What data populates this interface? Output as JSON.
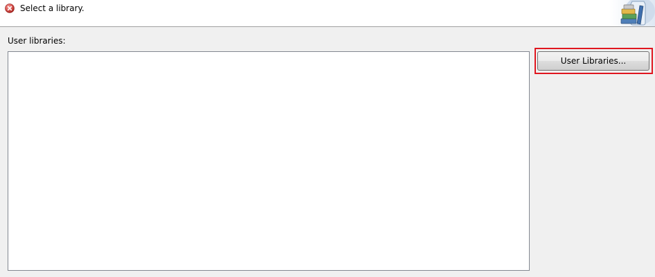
{
  "header": {
    "message": "Select a library.",
    "status_icon": "error-icon",
    "banner_icon": "library-books-icon"
  },
  "user_libraries": {
    "label": "User libraries:",
    "items": [],
    "button_label": "User Libraries..."
  },
  "colors": {
    "highlight": "#e0161f",
    "error_icon": "#d9534f"
  }
}
